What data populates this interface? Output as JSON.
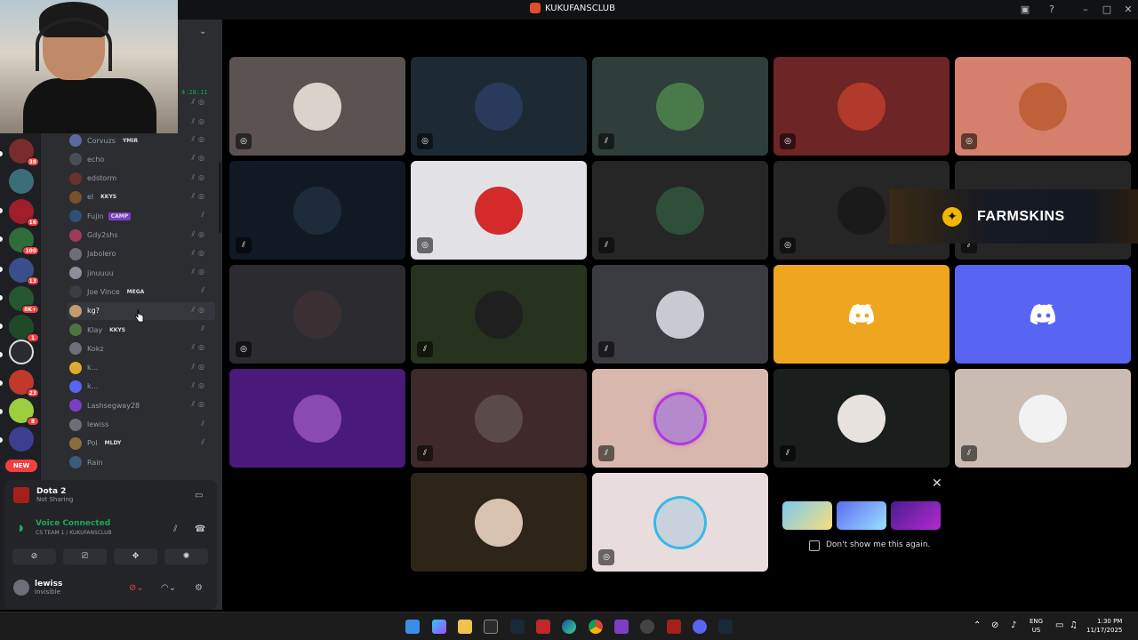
{
  "window": {
    "title": "KUKUFANSCLUB"
  },
  "rail": {
    "badges": [
      "38",
      "16",
      "100",
      "13",
      "8K+",
      "1",
      "23",
      "8"
    ],
    "new_label": "NEW"
  },
  "channel": {
    "timer": "4:28:11",
    "members": [
      {
        "name": "Corvuzs",
        "tag": "YMIR",
        "tag_color": "#2b2d31"
      },
      {
        "name": "echo",
        "tag": "",
        "tag_color": ""
      },
      {
        "name": "edstorm",
        "tag": "",
        "tag_color": ""
      },
      {
        "name": "el",
        "tag": "KKYS",
        "tag_color": "#2b2d31"
      },
      {
        "name": "Fujin",
        "tag": "CAMP",
        "tag_color": "#7b3fc4"
      },
      {
        "name": "Gdy2shs",
        "tag": "",
        "tag_color": ""
      },
      {
        "name": "Jabolero",
        "tag": "",
        "tag_color": ""
      },
      {
        "name": "jinuuuu",
        "tag": "",
        "tag_color": ""
      },
      {
        "name": "Joe Vince",
        "tag": "MEGA",
        "tag_color": "#2b2d31"
      },
      {
        "name": "kg?",
        "tag": "",
        "tag_color": ""
      },
      {
        "name": "Klay",
        "tag": "KKYS",
        "tag_color": "#2b2d31"
      },
      {
        "name": "Kokz",
        "tag": "",
        "tag_color": ""
      },
      {
        "name": "k...",
        "tag": "",
        "tag_color": ""
      },
      {
        "name": "k...",
        "tag": "",
        "tag_color": ""
      },
      {
        "name": "Lashsegway28",
        "tag": "",
        "tag_color": ""
      },
      {
        "name": "lewiss",
        "tag": "",
        "tag_color": ""
      },
      {
        "name": "Pol",
        "tag": "MLDY",
        "tag_color": "#2b2d31"
      },
      {
        "name": "Rain",
        "tag": "",
        "tag_color": ""
      }
    ]
  },
  "activity": {
    "game": "Dota 2",
    "sharing": "Not Sharing"
  },
  "voice": {
    "status": "Voice Connected",
    "channel": "CS TEAM 1 / KUKUFANSCLUB"
  },
  "user": {
    "name": "lewiss",
    "status": "Invisible"
  },
  "ad": {
    "brand": "FARMSKINS"
  },
  "promo": {
    "checkbox_label": "Don't show me this again."
  },
  "tray": {
    "lang": "ENG",
    "region": "US",
    "time": "1:30 PM",
    "date": "11/17/2025"
  },
  "colors": {
    "accent": "#5865f2",
    "green": "#23a55a",
    "red": "#f23f43",
    "yellow_tile": "#f0a51f"
  }
}
